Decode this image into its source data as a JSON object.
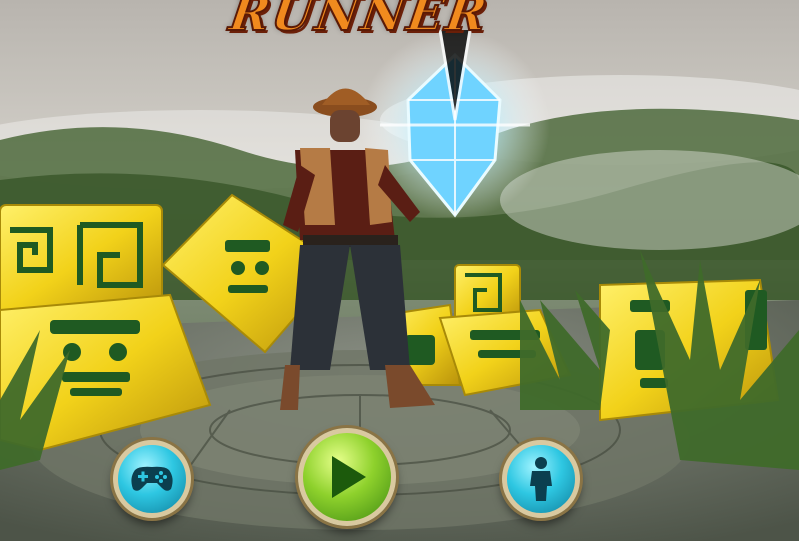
{
  "game": {
    "title_visible": "RUNNER"
  },
  "menu": {
    "buttons": [
      {
        "id": "controller",
        "icon": "gamepad-icon"
      },
      {
        "id": "play",
        "icon": "play-icon"
      },
      {
        "id": "character",
        "icon": "person-icon"
      }
    ]
  },
  "colors": {
    "title_orange": "#f08a1e",
    "title_outline": "#5a1a06",
    "button_teal": "#2ec7e2",
    "button_green": "#8ed12c",
    "button_rim": "#d9c9a0",
    "idol_block_yellow": "#f2d21a",
    "glyph_green": "#1f5a22",
    "crystal_blue": "#6fd3ff"
  }
}
